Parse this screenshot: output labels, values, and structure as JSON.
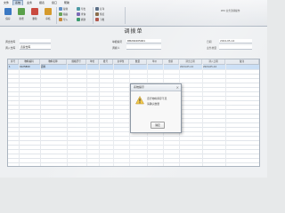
{
  "ribbon": {
    "tabs": [
      "文件",
      "系统",
      "业务",
      "报表",
      "窗口",
      "帮助"
    ],
    "active_tab_index": 1,
    "large_buttons": [
      {
        "label": "保存",
        "icon": "save-icon",
        "color": "#3a78c3"
      },
      {
        "label": "新增",
        "icon": "new-doc-icon",
        "color": "#5aa04a"
      },
      {
        "label": "删除",
        "icon": "delete-icon",
        "color": "#c94a3f"
      },
      {
        "label": "审核",
        "icon": "approve-icon",
        "color": "#d59a2c"
      }
    ],
    "small_buttons": [
      {
        "label": "复制",
        "icon": "copy-icon",
        "color": "#5f8fc6"
      },
      {
        "label": "粘贴",
        "icon": "paste-icon",
        "color": "#6aa45a"
      },
      {
        "label": "导入",
        "icon": "import-icon",
        "color": "#c7883b"
      },
      {
        "label": "导出",
        "icon": "export-icon",
        "color": "#4d9aa5"
      },
      {
        "label": "查询",
        "icon": "search-icon",
        "color": "#7b6bb5"
      },
      {
        "label": "刷新",
        "icon": "refresh-icon",
        "color": "#3c9b6e"
      },
      {
        "label": "打印",
        "icon": "print-icon",
        "color": "#5b6f87"
      },
      {
        "label": "预览",
        "icon": "preview-icon",
        "color": "#8a6e4c"
      },
      {
        "label": "下推",
        "icon": "push-icon",
        "color": "#b1584e"
      }
    ],
    "right_label": "RTX 业务流转操作"
  },
  "document": {
    "title": "调拨单",
    "fields": [
      {
        "label": "调出仓库",
        "value": ""
      },
      {
        "label": "调入仓库",
        "value": "直营仓库"
      },
      {
        "label": "单据编号",
        "value": "DB202405001"
      },
      {
        "label": "调拨人",
        "value": ""
      },
      {
        "label": "日期",
        "value": "2024-05-14"
      },
      {
        "label": "业务类型",
        "value": ""
      }
    ]
  },
  "grid": {
    "columns": [
      "序号",
      "物料编码",
      "物料名称",
      "规格型号",
      "单位",
      "批号",
      "主单位",
      "数量",
      "单价",
      "金额",
      "调出日期",
      "调入日期",
      "备注"
    ],
    "rows": [
      [
        "1",
        "0125809",
        "面料",
        "",
        "",
        "",
        "",
        "",
        "",
        "",
        "2024-05-14",
        "2024-05-14",
        ""
      ]
    ],
    "empty_rows": 22
  },
  "dialog": {
    "title": "系统提示",
    "message_line1": "该行物料库存不足",
    "message_line2": "请确认数量",
    "ok_label": "确定",
    "close_glyph": "×"
  }
}
